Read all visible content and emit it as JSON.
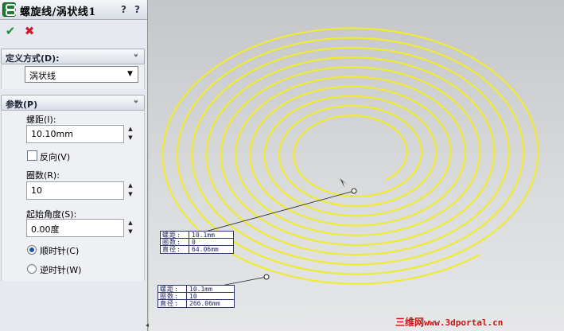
{
  "title": "螺旋线/涡状线1",
  "help_label": "?",
  "whats_new_label": "?",
  "ok_symbol": "✔",
  "cancel_symbol": "✖",
  "define_group": {
    "label": "定义方式(D):",
    "selected": "涡状线"
  },
  "params_group": {
    "label": "参数(P)",
    "pitch_label": "螺距(I):",
    "pitch_value": "10.10mm",
    "reverse_label": "反向(V)",
    "reverse_checked": false,
    "revolutions_label": "圈数(R):",
    "revolutions_value": "10",
    "start_angle_label": "起始角度(S):",
    "start_angle_value": "0.00度",
    "clockwise_label": "顺时针(C)",
    "counterclockwise_label": "逆时针(W)",
    "direction": "clockwise"
  },
  "callout_inner": {
    "pitch_key": "螺距:",
    "pitch_val": "10.1mm",
    "revs_key": "圈数:",
    "revs_val": "0",
    "diam_key": "直径:",
    "diam_val": "64.06mm"
  },
  "callout_outer": {
    "pitch_key": "螺距:",
    "pitch_val": "10.1mm",
    "revs_key": "圈数:",
    "revs_val": "10",
    "diam_key": "直径:",
    "diam_val": "266.06mm"
  },
  "watermark": {
    "cn": "三维网",
    "site": "www.3dportal.cn"
  },
  "colors": {
    "spiral": "#f0ea34",
    "accept": "#1b8e2e",
    "cancel": "#d4172b",
    "watermark": "#cc1212"
  }
}
